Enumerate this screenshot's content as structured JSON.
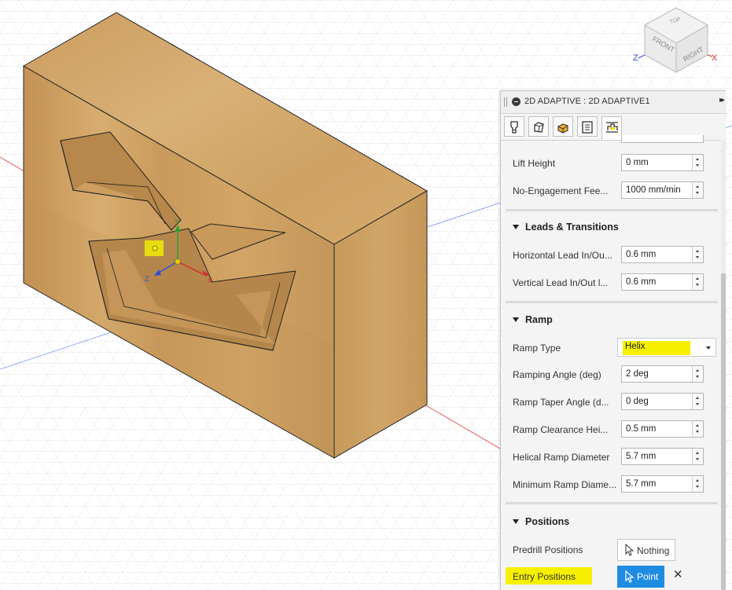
{
  "viewcube": {
    "top": "TOP",
    "front": "FRONT",
    "right": "RIGHT",
    "axis_z": "Z",
    "axis_x": "X"
  },
  "triad": {
    "x": "X",
    "y": "Y",
    "z": "Z"
  },
  "panel": {
    "title": "2D ADAPTIVE : 2D ADAPTIVE1",
    "tabs": [
      {
        "name": "tool-tab-icon"
      },
      {
        "name": "geometry-tab-icon"
      },
      {
        "name": "heights-tab-icon"
      },
      {
        "name": "passes-tab-icon"
      },
      {
        "name": "linking-tab-icon",
        "active": true
      }
    ],
    "fields_top": [
      {
        "label": "Lift Height",
        "value": "0 mm"
      },
      {
        "label": "No-Engagement Fee...",
        "value": "1000 mm/min"
      }
    ],
    "leads": {
      "title": "Leads & Transitions",
      "fields": [
        {
          "label": "Horizontal Lead In/Ou...",
          "value": "0.6 mm"
        },
        {
          "label": "Vertical Lead In/Out l...",
          "value": "0.6 mm"
        }
      ]
    },
    "ramp": {
      "title": "Ramp",
      "type_label": "Ramp Type",
      "type_value": "Helix",
      "fields": [
        {
          "label": "Ramping Angle (deg)",
          "value": "2 deg"
        },
        {
          "label": "Ramp Taper Angle (d...",
          "value": "0 deg"
        },
        {
          "label": "Ramp Clearance Hei...",
          "value": "0.5 mm"
        },
        {
          "label": "Helical Ramp Diameter",
          "value": "5.7 mm"
        },
        {
          "label": "Minimum Ramp Diame...",
          "value": "5.7 mm"
        }
      ]
    },
    "positions": {
      "title": "Positions",
      "predrill_label": "Predrill Positions",
      "predrill_value": "Nothing",
      "entry_label": "Entry Positions",
      "entry_value": "Point",
      "clear_symbol": "✕"
    }
  },
  "colors": {
    "accent": "#1e8ce1",
    "highlight": "#f5f000",
    "wood_light": "#d5a867",
    "wood_mid": "#c99a5a",
    "wood_dark": "#a8763f"
  }
}
